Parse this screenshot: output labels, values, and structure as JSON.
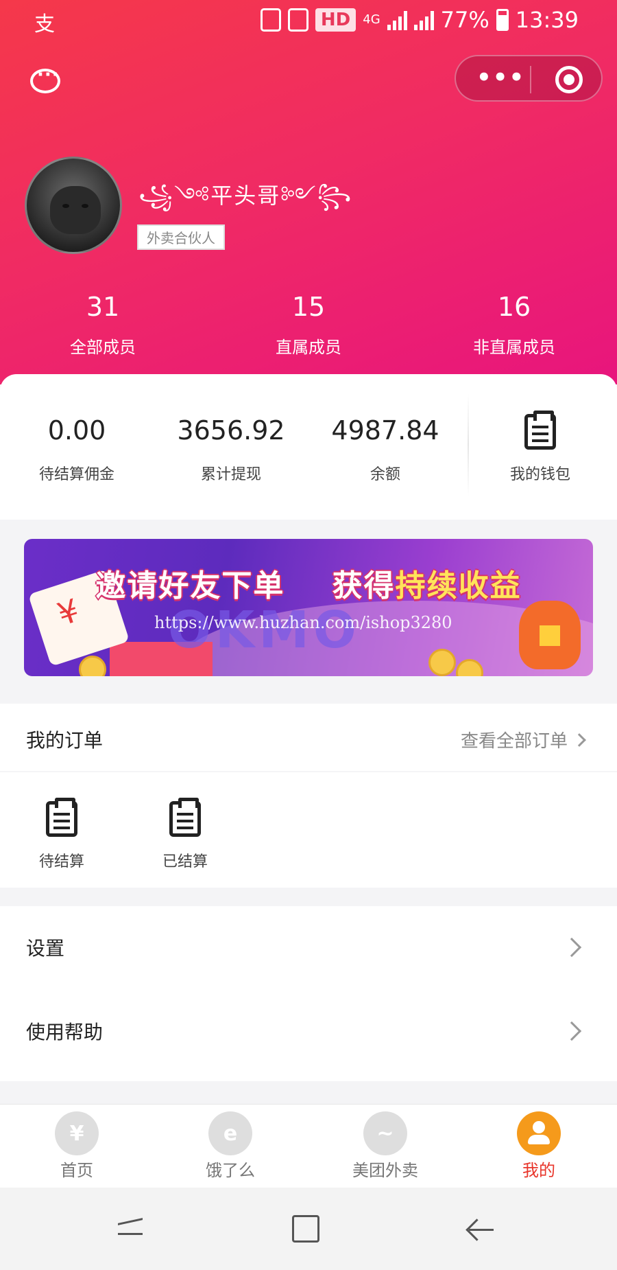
{
  "status_bar": {
    "carrier_glyph": "支",
    "hd": "HD",
    "network": "4G",
    "battery": "77%",
    "time": "13:39"
  },
  "capsule": {
    "more_glyph": "•••"
  },
  "profile": {
    "name": "平头哥",
    "badge": "外卖合伙人"
  },
  "members": [
    {
      "value": "31",
      "label": "全部成员"
    },
    {
      "value": "15",
      "label": "直属成员"
    },
    {
      "value": "16",
      "label": "非直属成员"
    }
  ],
  "wallet": {
    "items": [
      {
        "value": "0.00",
        "label": "待结算佣金"
      },
      {
        "value": "3656.92",
        "label": "累计提现"
      },
      {
        "value": "4987.84",
        "label": "余额"
      }
    ],
    "purse_label": "我的钱包"
  },
  "banner": {
    "title_part1": "邀请好友下单",
    "title_part2": "获得",
    "title_highlight": "持续收益",
    "brand": "OKMO",
    "watermark": "https://www.huzhan.com/ishop3280"
  },
  "orders": {
    "title": "我的订单",
    "view_all": "查看全部订单",
    "items": [
      {
        "label": "待结算"
      },
      {
        "label": "已结算"
      }
    ]
  },
  "menu": [
    {
      "label": "设置"
    },
    {
      "label": "使用帮助"
    }
  ],
  "tabs": [
    {
      "label": "首页",
      "icon": "receipt-icon"
    },
    {
      "label": "饿了么",
      "icon": "eleme-icon"
    },
    {
      "label": "美团外卖",
      "icon": "kangaroo-icon"
    },
    {
      "label": "我的",
      "icon": "user-icon"
    }
  ],
  "colors": {
    "header_start": "#f5384a",
    "header_end": "#e8157d",
    "active_tab": "#e8352a",
    "active_icon": "#f59a1b"
  }
}
